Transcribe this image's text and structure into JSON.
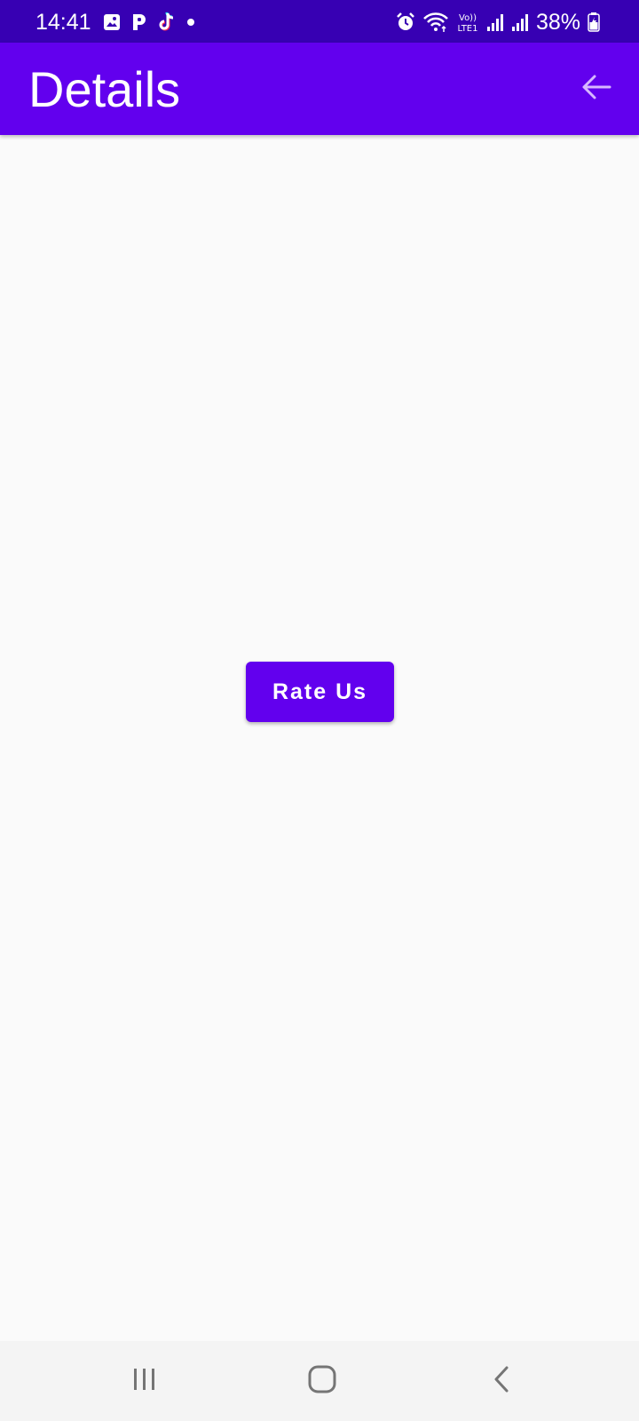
{
  "status_bar": {
    "time": "14:41",
    "left_icons": [
      "gallery-icon",
      "p-app-icon",
      "tiktok-icon",
      "dot-icon"
    ],
    "right_icons": [
      "alarm-icon",
      "wifi-icon",
      "volte-icon",
      "signal-icon",
      "signal-icon-2",
      "battery-icon"
    ],
    "volte_label_top": "Vo))",
    "volte_label_bottom": "LTE1",
    "battery_percent": "38%",
    "background_color": "#3700b3"
  },
  "app_bar": {
    "title": "Details",
    "back_icon": "arrow-back-icon",
    "background_color": "#6200ee"
  },
  "main": {
    "rate_button_label": "Rate Us",
    "button_color": "#6200ee"
  },
  "nav_bar": {
    "icons": [
      "recents-icon",
      "home-icon",
      "back-icon"
    ]
  }
}
